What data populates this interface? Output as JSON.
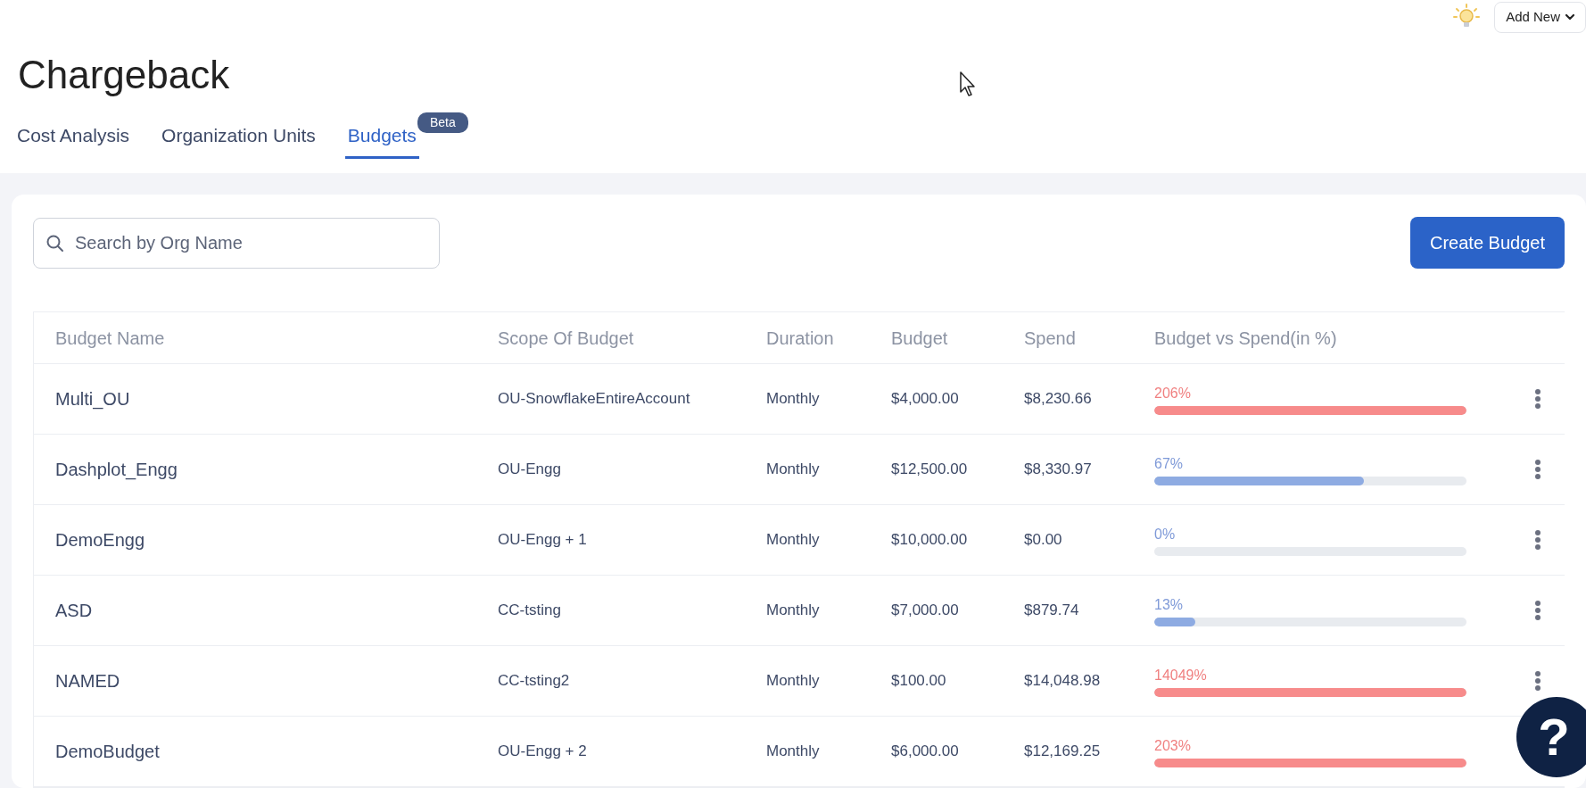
{
  "header": {
    "add_new_label": "Add New"
  },
  "page": {
    "title": "Chargeback"
  },
  "tabs": [
    {
      "label": "Cost Analysis",
      "selected": false
    },
    {
      "label": "Organization Units",
      "selected": false
    },
    {
      "label": "Budgets",
      "selected": true,
      "badge": "Beta"
    }
  ],
  "search": {
    "placeholder": "Search by Org Name"
  },
  "create_button": "Create Budget",
  "table": {
    "columns": [
      "Budget Name",
      "Scope Of Budget",
      "Duration",
      "Budget",
      "Spend",
      "Budget vs Spend(in %)"
    ],
    "rows": [
      {
        "name": "Multi_OU",
        "scope": "OU-SnowflakeEntireAccount",
        "duration": "Monthly",
        "budget": "$4,000.00",
        "spend": "$8,230.66",
        "percent": "206%",
        "level": 1,
        "over_budget": true
      },
      {
        "name": "Dashplot_Engg",
        "scope": "OU-Engg",
        "duration": "Monthly",
        "budget": "$12,500.00",
        "spend": "$8,330.97",
        "percent": "67%",
        "level": 0.67,
        "over_budget": false
      },
      {
        "name": "DemoEngg",
        "scope": "OU-Engg + 1",
        "duration": "Monthly",
        "budget": "$10,000.00",
        "spend": "$0.00",
        "percent": "0%",
        "level": 0,
        "over_budget": false
      },
      {
        "name": "ASD",
        "scope": "CC-tsting",
        "duration": "Monthly",
        "budget": "$7,000.00",
        "spend": "$879.74",
        "percent": "13%",
        "level": 0.13,
        "over_budget": false
      },
      {
        "name": "NAMED",
        "scope": "CC-tsting2",
        "duration": "Monthly",
        "budget": "$100.00",
        "spend": "$14,048.98",
        "percent": "14049%",
        "level": 1,
        "over_budget": true
      },
      {
        "name": "DemoBudget",
        "scope": "OU-Engg + 2",
        "duration": "Monthly",
        "budget": "$6,000.00",
        "spend": "$12,169.25",
        "percent": "203%",
        "level": 1,
        "over_budget": true
      }
    ]
  },
  "help_button": "?"
}
